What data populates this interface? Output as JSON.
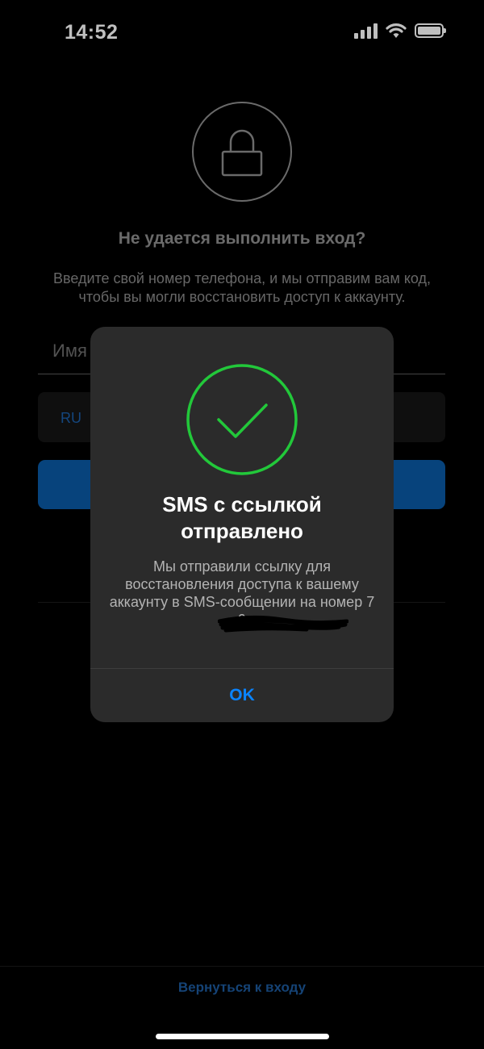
{
  "status_bar": {
    "time": "14:52",
    "icons": [
      "cellular-signal-icon",
      "wifi-icon",
      "battery-icon"
    ]
  },
  "background": {
    "icon": "lock-icon",
    "title": "Не удается выполнить вход?",
    "description": "Введите свой номер телефона, и мы отправим вам код, чтобы вы могли восстановить доступ к аккаунту.",
    "name_input_placeholder": "Имя",
    "phone_country_code": "RU",
    "back_link": "Вернуться к входу"
  },
  "alert": {
    "icon": "checkmark-circle-icon",
    "title": "SMS с ссылкой отправлено",
    "message": "Мы отправили ссылку для восстановления доступа к вашему аккаунту в SMS-сообщении на номер 7 9",
    "ok_label": "OK"
  },
  "colors": {
    "background": "#000000",
    "alert_bg": "#2b2b2b",
    "success_green": "#22c83a",
    "accent_blue": "#0a84ff",
    "primary_button": "#0a5aa6"
  }
}
